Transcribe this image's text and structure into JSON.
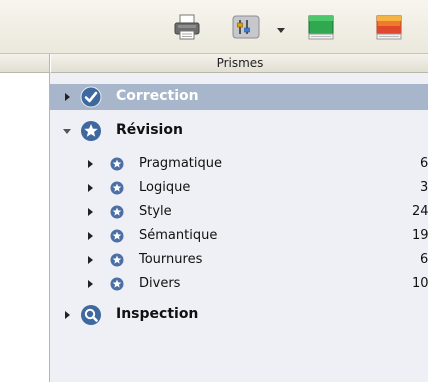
{
  "toolbar": {
    "icons": [
      "printer-icon",
      "settings-icon",
      "dropdown-arrow-icon",
      "green-book-icon",
      "orange-book-icon"
    ]
  },
  "panel": {
    "column_header": "Prismes"
  },
  "tree": {
    "correction": {
      "label": "Correction",
      "icon": "check-icon",
      "expanded": false,
      "selected": true
    },
    "revision": {
      "label": "Révision",
      "icon": "star-icon",
      "expanded": true,
      "items": [
        {
          "label": "Pragmatique",
          "count": "6"
        },
        {
          "label": "Logique",
          "count": "3"
        },
        {
          "label": "Style",
          "count": "24"
        },
        {
          "label": "Sémantique",
          "count": "19"
        },
        {
          "label": "Tournures",
          "count": "6"
        },
        {
          "label": "Divers",
          "count": "10"
        }
      ]
    },
    "inspection": {
      "label": "Inspection",
      "icon": "magnifier-icon",
      "expanded": false
    }
  },
  "colors": {
    "selection": "#a8b6cc",
    "panel_background": "#eef0f5",
    "category_icon": "#4a6fa5"
  }
}
